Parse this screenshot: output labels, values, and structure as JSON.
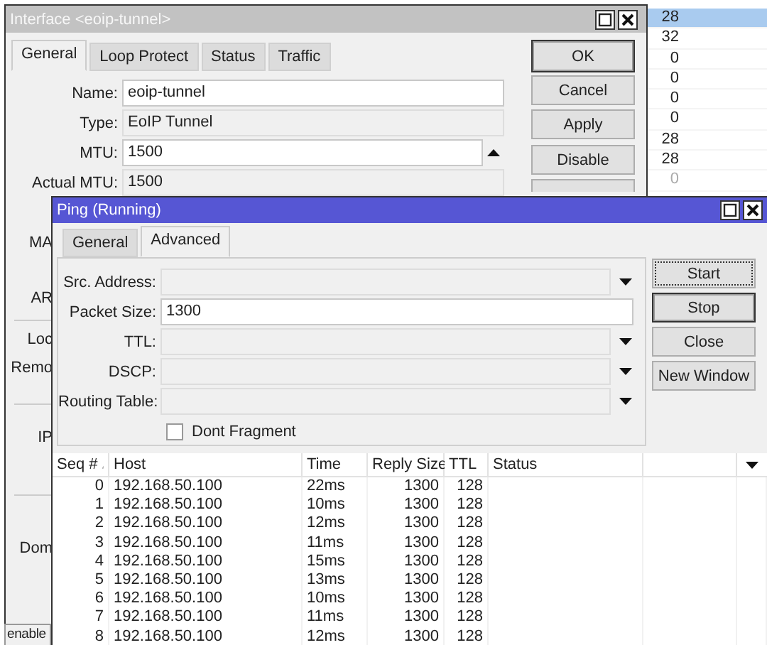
{
  "background_list": {
    "rows": [
      {
        "value": "28",
        "selected": true,
        "disabled": false
      },
      {
        "value": "32",
        "selected": false,
        "disabled": false
      },
      {
        "value": "0",
        "selected": false,
        "disabled": false
      },
      {
        "value": "0",
        "selected": false,
        "disabled": false
      },
      {
        "value": "0",
        "selected": false,
        "disabled": false
      },
      {
        "value": "0",
        "selected": false,
        "disabled": false
      },
      {
        "value": "28",
        "selected": false,
        "disabled": false
      },
      {
        "value": "28",
        "selected": false,
        "disabled": false
      },
      {
        "value": "0",
        "selected": false,
        "disabled": true
      }
    ]
  },
  "interface_window": {
    "title": "Interface <eoip-tunnel>",
    "tabs": [
      {
        "label": "General",
        "selected": true
      },
      {
        "label": "Loop Protect",
        "selected": false
      },
      {
        "label": "Status",
        "selected": false
      },
      {
        "label": "Traffic",
        "selected": false
      }
    ],
    "fields": [
      {
        "label": "Name:",
        "value": "eoip-tunnel",
        "kind": "text"
      },
      {
        "label": "Type:",
        "value": "EoIP Tunnel",
        "kind": "readonly"
      },
      {
        "label": "MTU:",
        "value": "1500",
        "kind": "spinner"
      },
      {
        "label": "Actual MTU:",
        "value": "1500",
        "kind": "readonly"
      }
    ],
    "covered_labels": [
      "MA",
      "AR",
      "Loc",
      "Remo",
      "IP",
      "Dom"
    ],
    "buttons": [
      {
        "label": "OK",
        "default": true
      },
      {
        "label": "Cancel",
        "default": false
      },
      {
        "label": "Apply",
        "default": false
      },
      {
        "label": "Disable",
        "default": false
      }
    ],
    "status_bar": "enable"
  },
  "ping_window": {
    "title": "Ping (Running)",
    "tabs": [
      {
        "label": "General",
        "selected": false
      },
      {
        "label": "Advanced",
        "selected": true
      }
    ],
    "fields": [
      {
        "label": "Src. Address:",
        "kind": "dropdown"
      },
      {
        "label": "Packet Size:",
        "value": "1300",
        "kind": "text"
      },
      {
        "label": "TTL:",
        "kind": "dropdown"
      },
      {
        "label": "DSCP:",
        "kind": "dropdown"
      },
      {
        "label": "Routing Table:",
        "kind": "dropdown"
      }
    ],
    "checkbox": {
      "label": "Dont Fragment",
      "checked": false
    },
    "buttons": [
      {
        "label": "Start",
        "default": false,
        "focused": true
      },
      {
        "label": "Stop",
        "default": true,
        "focused": false
      },
      {
        "label": "Close",
        "default": false,
        "focused": false
      },
      {
        "label": "New Window",
        "default": false,
        "focused": false
      }
    ],
    "table": {
      "columns": [
        "Seq #",
        "Host",
        "Time",
        "Reply Size",
        "TTL",
        "Status"
      ],
      "rows": [
        [
          "0",
          "192.168.50.100",
          "22ms",
          "1300",
          "128"
        ],
        [
          "1",
          "192.168.50.100",
          "10ms",
          "1300",
          "128"
        ],
        [
          "2",
          "192.168.50.100",
          "12ms",
          "1300",
          "128"
        ],
        [
          "3",
          "192.168.50.100",
          "11ms",
          "1300",
          "128"
        ],
        [
          "4",
          "192.168.50.100",
          "15ms",
          "1300",
          "128"
        ],
        [
          "5",
          "192.168.50.100",
          "13ms",
          "1300",
          "128"
        ],
        [
          "6",
          "192.168.50.100",
          "10ms",
          "1300",
          "128"
        ],
        [
          "7",
          "192.168.50.100",
          "11ms",
          "1300",
          "128"
        ],
        [
          "8",
          "192.168.50.100",
          "12ms",
          "1300",
          "128"
        ]
      ]
    }
  }
}
